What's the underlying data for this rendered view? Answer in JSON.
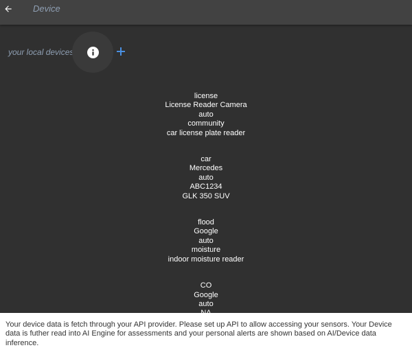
{
  "app_bar": {
    "title": "Device",
    "back_icon": "arrow-left-icon"
  },
  "devices_header": {
    "label": "your local devices",
    "info_icon": "info-icon",
    "add_icon": "plus-icon"
  },
  "colors": {
    "background": "#303030",
    "app_bar": "#424242",
    "muted_text": "#8f9fb3",
    "accent": "#4a90e2",
    "footer_bg": "#ffffff"
  },
  "devices": [
    {
      "type": "license",
      "name": "License Reader Camera",
      "mode": "auto",
      "source": "community",
      "description": "car license plate reader"
    },
    {
      "type": "car",
      "name": "Mercedes",
      "mode": "auto",
      "source": "ABC1234",
      "description": "GLK 350 SUV"
    },
    {
      "type": "flood",
      "name": "Google",
      "mode": "auto",
      "source": "moisture",
      "description": "indoor moisture reader"
    },
    {
      "type": "CO",
      "name": "Google",
      "mode": "auto",
      "source": "NA",
      "description": ""
    }
  ],
  "footer": {
    "text": "Your device data is fetch through your API provider. Please set up API to allow accessing your sensors. Your Device data is futher read into AI Engine for assessments and your personal alerts are shown based on AI/Device data inference."
  }
}
